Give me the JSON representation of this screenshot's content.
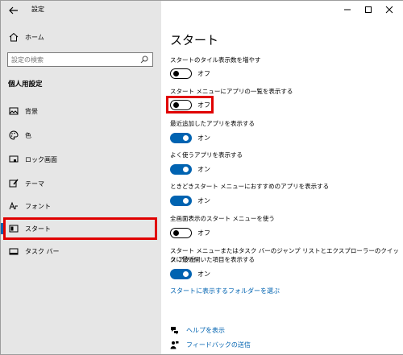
{
  "app": {
    "title": "設定"
  },
  "sidebar": {
    "home_label": "ホーム",
    "search_placeholder": "設定の検索",
    "section_title": "個人用設定",
    "items": [
      {
        "label": "背景",
        "icon": "picture-icon"
      },
      {
        "label": "色",
        "icon": "palette-icon"
      },
      {
        "label": "ロック画面",
        "icon": "lock-screen-icon"
      },
      {
        "label": "テーマ",
        "icon": "theme-brush-icon"
      },
      {
        "label": "フォント",
        "icon": "font-icon"
      },
      {
        "label": "スタート",
        "icon": "start-icon",
        "selected": true
      },
      {
        "label": "タスク バー",
        "icon": "taskbar-icon"
      }
    ]
  },
  "main": {
    "title": "スタート",
    "settings": [
      {
        "label": "スタートのタイル表示数を増やす",
        "state": "オフ",
        "on": false
      },
      {
        "label": "スタート メニューにアプリの一覧を表示する",
        "state": "オフ",
        "on": false
      },
      {
        "label": "最近追加したアプリを表示する",
        "state": "オン",
        "on": true
      },
      {
        "label": "よく使うアプリを表示する",
        "state": "オン",
        "on": true
      },
      {
        "label": "ときどきスタート メニューにおすすめのアプリを表示する",
        "state": "オン",
        "on": true
      },
      {
        "label": "全画面表示のスタート メニューを使う",
        "state": "オフ",
        "on": false
      },
      {
        "label_line1": "スタート メニューまたはタスク バーのジャンプ リストとエクスプローラーのクイック アクセ",
        "label_line2": "スに最近開いた項目を表示する",
        "state": "オン",
        "on": true
      }
    ],
    "folder_link": "スタートに表示するフォルダーを選ぶ",
    "help_link": "ヘルプを表示",
    "feedback_link": "フィードバックの送信"
  },
  "colors": {
    "accent": "#0063b1",
    "highlight": "#e00000",
    "sidebar_bg": "#e6e6e6"
  }
}
